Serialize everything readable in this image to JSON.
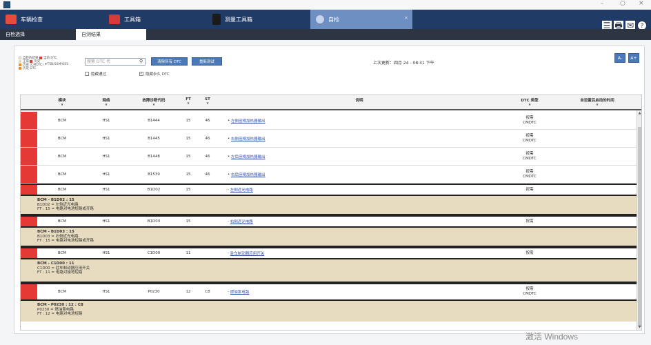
{
  "window": {
    "minimize": "–",
    "restore": "○",
    "close": "×"
  },
  "main_tabs": [
    {
      "label": "车辆检查",
      "icon": "car-diagnostic-icon",
      "icon_color": "#e84a3c"
    },
    {
      "label": "工具箱",
      "icon": "toolbox-icon",
      "icon_color": "#d63b3b"
    },
    {
      "label": "测量工具箱",
      "icon": "meter-icon",
      "icon_color": "#1a1a1a"
    },
    {
      "label": "自检",
      "icon": "self-test-icon",
      "icon_color": "#c6d3ea"
    }
  ],
  "top_icons": {
    "menu": "☰",
    "printer": "🖶",
    "mail": "✉",
    "help": "?"
  },
  "sub_tabs": [
    "自检选择",
    "自测结果"
  ],
  "legend": [
    {
      "label": "自检的结果",
      "color": "#f3f3f3"
    },
    {
      "label": "当前 DTC",
      "color": "#e53935"
    },
    {
      "label": "正常",
      "color": "#e8dcc0"
    },
    {
      "label": "历史",
      "color": "#e53935"
    },
    {
      "label": "历史 (CMDTC)",
      "color": "#f28c28"
    },
    {
      "label": "TSB/SSM/OSS",
      "color": "#333333"
    },
    {
      "label": "历史 DTC",
      "color": "#f28c28"
    }
  ],
  "toolbar": {
    "search_placeholder": "搜索 DTC 代",
    "clear_dtc": "清除所有 DTC",
    "retest": "重新测试",
    "hide_passed": "隐藏通过",
    "hide_permanent": "隐藏永久 DTC",
    "hide_permanent_check": "✓",
    "last_updated": "上次更新：四月 24 - 08:31 下午",
    "font_smaller": "A-",
    "font_larger": "A+"
  },
  "table": {
    "headers": [
      "模块",
      "网络",
      "故障诊断代码",
      "FT",
      "ST",
      "说明",
      "DTC 类型",
      "自设置后启动的时间"
    ],
    "rows": [
      {
        "module": "BCM",
        "network": "HS1",
        "code": "B1444",
        "ft": "15",
        "st": "46",
        "desc": "左侧座椅加热器输出",
        "dtc1": "按需",
        "dtc2": "CMDTC"
      },
      {
        "module": "BCM",
        "network": "HS1",
        "code": "B1445",
        "ft": "15",
        "st": "46",
        "desc": "右侧座椅加热器输出",
        "dtc1": "按需",
        "dtc2": "CMDTC"
      },
      {
        "module": "BCM",
        "network": "HS1",
        "code": "B1448",
        "ft": "15",
        "st": "46",
        "desc": "左后座椅加热器输出",
        "dtc1": "按需",
        "dtc2": "CMDTC"
      },
      {
        "module": "BCM",
        "network": "HS1",
        "code": "B1539",
        "ft": "15",
        "st": "46",
        "desc": "右后座椅加热器输出",
        "dtc1": "按需",
        "dtc2": "CMDTC"
      },
      {
        "module": "BCM",
        "network": "HS1",
        "code": "B1D02",
        "ft": "15",
        "st": "",
        "desc": "左侧近光电路",
        "dtc1": "按需",
        "dtc2": ""
      },
      {
        "module": "BCM",
        "network": "HS1",
        "code": "B1D03",
        "ft": "15",
        "st": "",
        "desc": "右侧近光电路",
        "dtc1": "按需",
        "dtc2": ""
      },
      {
        "module": "BCM",
        "network": "HS1",
        "code": "C1D00",
        "ft": "11",
        "st": "",
        "desc": "驻车制动器应用开关",
        "dtc1": "按需",
        "dtc2": ""
      },
      {
        "module": "BCM",
        "network": "HS1",
        "code": "P0230",
        "ft": "12",
        "st": "C8",
        "desc": "燃油泵电路",
        "dtc1": "按需",
        "dtc2": "CMDTC"
      }
    ],
    "details": [
      {
        "title": "BCM - B1D02 : 15",
        "line1": "B1D02 = 左侧近光电路",
        "line2": "FT : 15 = 电路对电池短路或开路"
      },
      {
        "title": "BCM - B1D03 : 15",
        "line1": "B1D03 = 右侧近光电路",
        "line2": "FT : 15 = 电路对电池短路或开路"
      },
      {
        "title": "BCM - C1D00 : 11",
        "line1": "C1D00 = 驻车制动器应用开关",
        "line2": "FT : 11 = 电路对接地短路"
      },
      {
        "title": "BCM - P0230 : 12 : C8",
        "line1": "P0230 = 燃油泵电路",
        "line2": "FT : 12 = 电路对电池短路"
      }
    ]
  },
  "scrollbar": {
    "up": "▲",
    "down": "▼"
  },
  "watermark": "激活 Windows"
}
